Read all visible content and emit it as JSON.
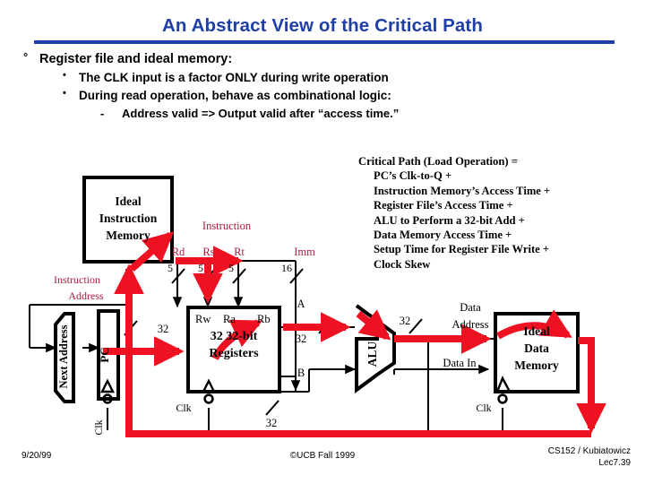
{
  "slide": {
    "title": "An Abstract View of the Critical Path",
    "title_color": "#1f3fa8",
    "bullets": {
      "level1_mark": "°",
      "level1": "Register file and ideal memory:",
      "level2_mark": "•",
      "level2_a": "The CLK input is a factor ONLY during write operation",
      "level2_b": "During read operation, behave as combinational logic:",
      "level3_mark": "-",
      "level3": "Address valid => Output valid after “access time.”"
    }
  },
  "critical_path": {
    "line1": "Critical Path (Load Operation) =",
    "line2": "PC’s Clk-to-Q +",
    "line3": "Instruction Memory’s Access Time +",
    "line4": "Register File’s Access Time +",
    "line5": "ALU to Perform a 32-bit Add +",
    "line6": "Data Memory Access Time +",
    "line7": "Setup Time for Register File Write +",
    "line8": "Clock Skew"
  },
  "diagram": {
    "critical_path_color": "#ee1122",
    "wire_color": "#000000",
    "label_red_color": "#a81c3c",
    "blocks": {
      "instruction_memory": "Ideal\nInstruction\nMemory",
      "instruction_memory_l1": "Ideal",
      "instruction_memory_l2": "Instruction",
      "instruction_memory_l3": "Memory",
      "next_address": "Next Address",
      "pc": "PC",
      "register_file_l1": "32 32-bit",
      "register_file_l2": "Registers",
      "alu": "ALU",
      "data_memory_l1": "Ideal",
      "data_memory_l2": "Data",
      "data_memory_l3": "Memory"
    },
    "labels": {
      "instruction_address_l1": "Instruction",
      "instruction_address_l2": "Address",
      "instruction": "Instruction",
      "rd": "Rd",
      "rs": "Rs",
      "rt": "Rt",
      "imm": "Imm",
      "rw": "Rw",
      "ra": "Ra",
      "rb": "Rb",
      "port_a": "A",
      "port_b": "B",
      "data_address_l1": "Data",
      "data_address_l2": "Address",
      "data_in": "Data In",
      "clk_pc": "Clk",
      "clk_regfile": "Clk",
      "clk_datamem": "Clk"
    },
    "bus_widths": {
      "rd": "5",
      "rs": "5",
      "rt": "5",
      "imm": "16",
      "pc_out": "32",
      "reg_a": "32",
      "reg_b": "32",
      "alu_out": "32",
      "writeback": "32"
    }
  },
  "footer": {
    "date": "9/20/99",
    "center": "©UCB Fall 1999",
    "course": "CS152 / Kubiatowicz",
    "lecture": "Lec7.39"
  }
}
